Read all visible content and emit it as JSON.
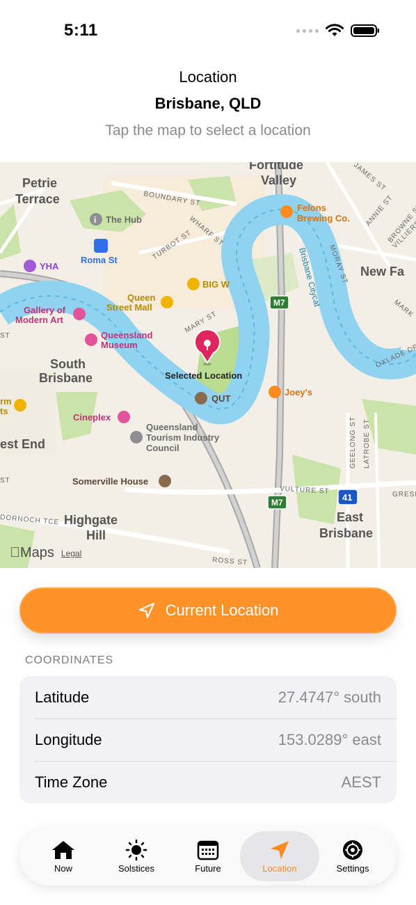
{
  "status": {
    "time": "5:11"
  },
  "header": {
    "subtitle": "Location",
    "title": "Brisbane, QLD",
    "hint": "Tap the map to select a location"
  },
  "map": {
    "labels": {
      "fortitude": "Fortitude",
      "valley": "Valley",
      "petrie": "Petrie",
      "terrace": "Terrace",
      "boundary_st": "BOUNDARY ST",
      "wharf_st": "WHARF ST",
      "the_hub": "The Hub",
      "turbot_st": "TURBOT ST",
      "roma_st": "Roma St",
      "yha": "YHA",
      "felons1": "Felons",
      "felons2": "Brewing Co.",
      "james_st": "JAMES ST",
      "annie_st": "ANNIE ST",
      "browne_st": "BROWNE ST",
      "villiers": "VILLIERS",
      "moray_st": "MORAY ST",
      "new_fa": "New Fa",
      "brisbane_citycat": "Brisbane Citycat",
      "big_w": "BIG W",
      "queen1": "Queen",
      "queen2": "Street Mall",
      "mary_st": "MARY ST",
      "m7_a": "M7",
      "gallery1": "Gallery of",
      "gallery2": "Modern Art",
      "qm1": "Queensland",
      "qm2": "Museum",
      "mark": "MARK",
      "oxlade_dr": "OXLADE DR",
      "south": "South",
      "brisbane_s": "Brisbane",
      "selected": "Selected Location",
      "qut": "QUT",
      "joeys": "Joey's",
      "rm1": "rm",
      "rm2": "ts",
      "cineplex": "Cineplex",
      "qtic1": "Queensland",
      "qtic2": "Tourism Industry",
      "qtic3": "Council",
      "est_end": "est End",
      "geelong": "GEELONG ST",
      "latrobe": "LATROBE ST",
      "somerville": "Somerville House",
      "vulture_st": "VULTURE ST",
      "gresh": "GRESH",
      "m41": "41",
      "m7_b": "M7",
      "dornoch": "DORNOCH TCE",
      "highgate1": "Highgate",
      "highgate2": "Hill",
      "east1": "East",
      "east2": "Brisbane",
      "ross_st": "ROSS ST",
      "st_left": "ST",
      "st_left2": "ST"
    },
    "brand": "Maps",
    "legal": "Legal"
  },
  "current_location_button": "Current Location",
  "coordinates": {
    "section_title": "COORDINATES",
    "rows": [
      {
        "key": "Latitude",
        "value": "27.4747° south"
      },
      {
        "key": "Longitude",
        "value": "153.0289° east"
      },
      {
        "key": "Time Zone",
        "value": "AEST"
      }
    ]
  },
  "tabs": [
    {
      "label": "Now",
      "icon": "house-icon"
    },
    {
      "label": "Solstices",
      "icon": "sun-icon"
    },
    {
      "label": "Future",
      "icon": "calendar-icon"
    },
    {
      "label": "Location",
      "icon": "location-arrow-icon"
    },
    {
      "label": "Settings",
      "icon": "gear-icon"
    }
  ],
  "colors": {
    "accent": "#ff9227",
    "river": "#8fd3f0",
    "park": "#c9e3a8",
    "pin": "#e0245e",
    "motorway_badge": "#2e7d32"
  }
}
